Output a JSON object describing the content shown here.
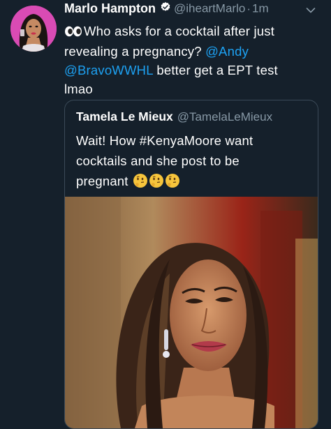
{
  "tweet": {
    "author_name": "Marlo Hampton",
    "handle": "@iheartMarlo",
    "separator": "·",
    "time": "1m",
    "text_lines": [
      "Who asks for a cocktail after just",
      "revealing a pregnancy? ",
      " better get a EPT test",
      "lmao"
    ],
    "mention_1": "@Andy",
    "mention_2": "@BravoWWHL",
    "verified_icon": "verified-badge-icon",
    "leading_emoji": "eyes-emoji"
  },
  "quoted_tweet": {
    "author_name": "Tamela Le Mieux",
    "handle": "@TamelaLeMieux",
    "text_lines": [
      "Wait! How #KenyaMoore want",
      "cocktails and she post to be",
      "pregnant"
    ],
    "trailing_emoji": "thinking-face-emoji x3"
  },
  "colors": {
    "background": "#15202b",
    "link": "#1da1f2",
    "secondary_text": "#8899a6",
    "card_border": "#3b4a58",
    "avatar_bg": "#d94bb4"
  }
}
